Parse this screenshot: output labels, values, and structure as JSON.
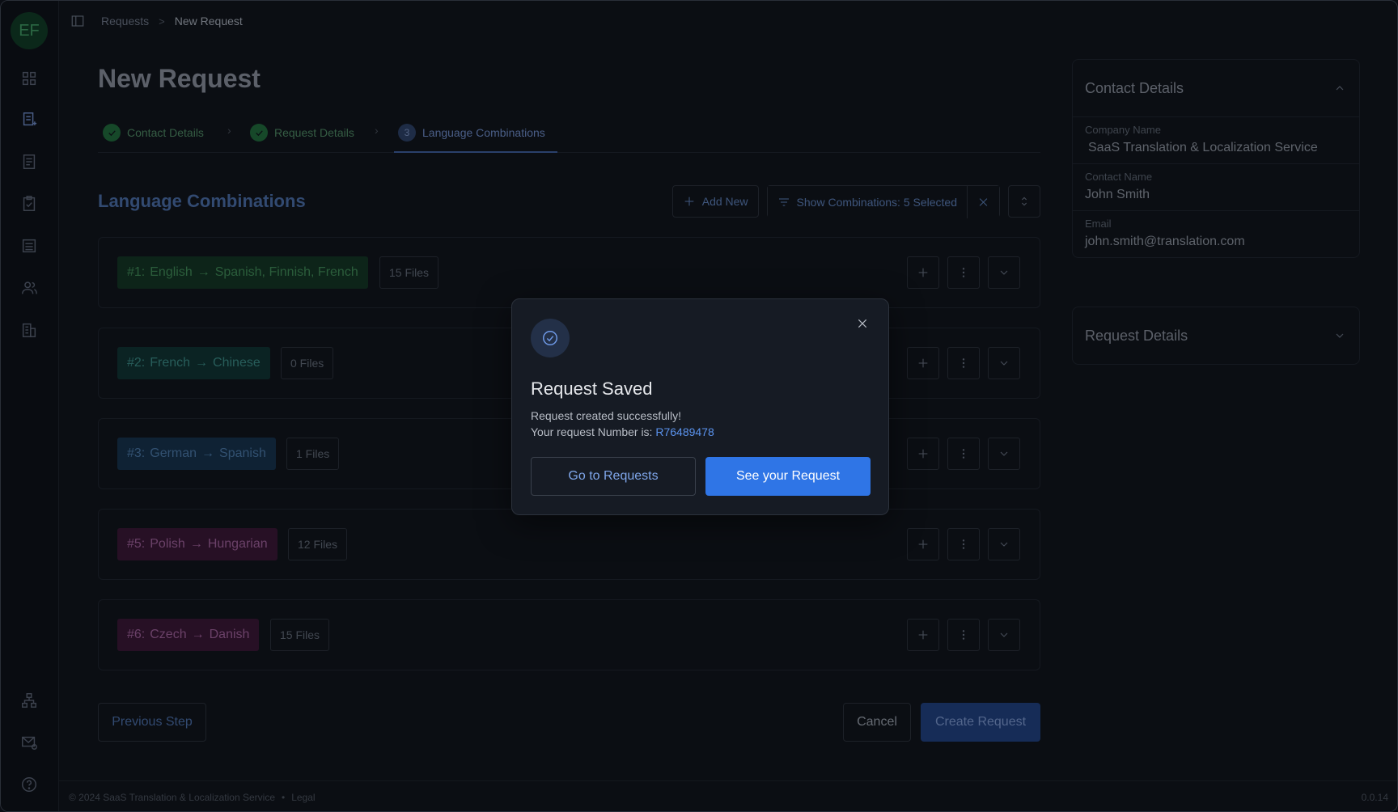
{
  "user": {
    "initials": "EF"
  },
  "breadcrumb": {
    "parent": "Requests",
    "separator": ">",
    "current": "New Request"
  },
  "page_title": "New Request",
  "stepper": {
    "steps": [
      {
        "label": "Contact Details",
        "state": "done"
      },
      {
        "label": "Request Details",
        "state": "done"
      },
      {
        "label": "Language Combinations",
        "state": "current",
        "number": "3"
      }
    ]
  },
  "section_title": "Language Combinations",
  "toolbar": {
    "add_new": "Add New",
    "show_combinations": "Show Combinations: 5 Selected"
  },
  "combinations": [
    {
      "prefix": "#1:",
      "source": "English",
      "targets": "Spanish,  Finnish, French",
      "files": "15 Files",
      "bg": "#123321",
      "fg": "#3f8a55"
    },
    {
      "prefix": "#2:",
      "source": "French",
      "targets": "Chinese",
      "files": "0 Files",
      "bg": "#0f3230",
      "fg": "#3a8a84"
    },
    {
      "prefix": "#3:",
      "source": "German",
      "targets": "Spanish",
      "files": "1 Files",
      "bg": "#14304a",
      "fg": "#4a78a8"
    },
    {
      "prefix": "#5:",
      "source": "Polish",
      "targets": "Hungarian",
      "files": "12 Files",
      "bg": "#3a1433",
      "fg": "#a0609a"
    },
    {
      "prefix": "#6:",
      "source": "Czech",
      "targets": "Danish",
      "files": "15 Files",
      "bg": "#3a1433",
      "fg": "#a0609a"
    }
  ],
  "buttons": {
    "previous": "Previous Step",
    "cancel": "Cancel",
    "create": "Create Request"
  },
  "contact_panel": {
    "title": "Contact Details",
    "fields": [
      {
        "label": "Company Name",
        "value": "SaaS Translation & Localization Service"
      },
      {
        "label": "Contact Name",
        "value": "John Smith"
      },
      {
        "label": "Email",
        "value": "john.smith@translation.com"
      }
    ]
  },
  "request_panel": {
    "title": "Request Details"
  },
  "footer": {
    "copyright": "© 2024 SaaS Translation & Localization Service",
    "dot": "•",
    "legal": "Legal",
    "version": "0.0.14"
  },
  "modal": {
    "title": "Request Saved",
    "line1": "Request created successfully!",
    "line2_prefix": "Your request Number is:",
    "request_number": "R76489478",
    "secondary_button": "Go to Requests",
    "primary_button": "See your Request"
  },
  "icons": {
    "sidebar": [
      "dashboard-icon",
      "request-icon",
      "document-icon",
      "checklist-icon",
      "list-icon",
      "users-icon",
      "building-icon",
      "hierarchy-icon",
      "mail-settings-icon",
      "help-icon"
    ]
  }
}
